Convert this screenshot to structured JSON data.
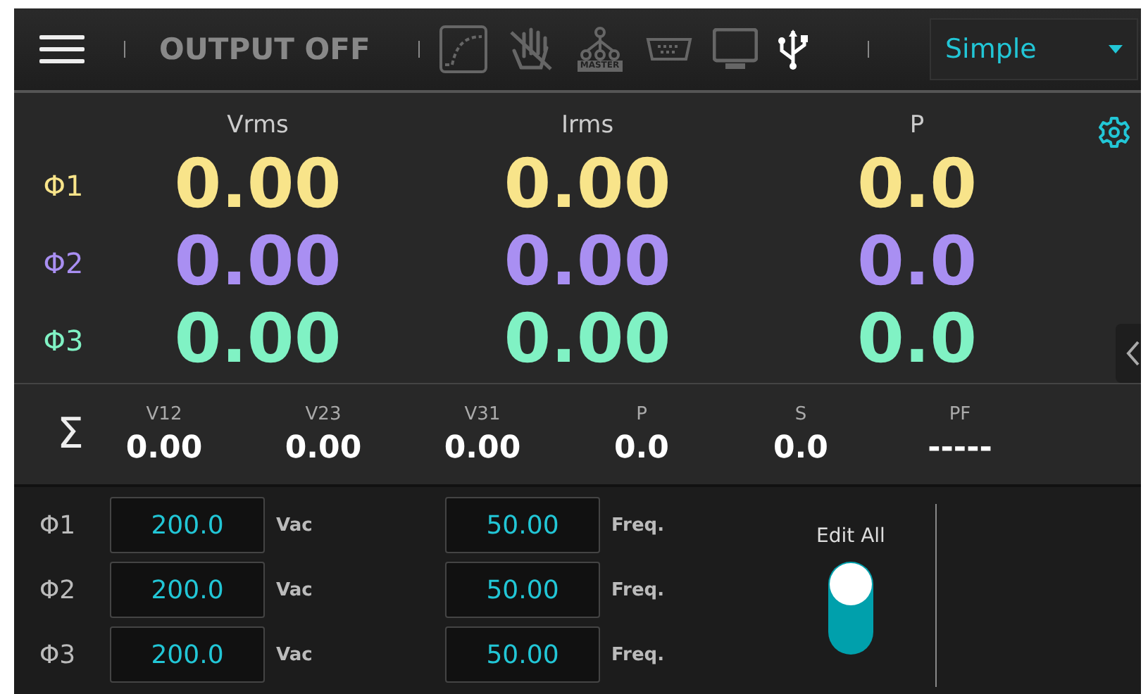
{
  "toolbar": {
    "status": "OUTPUT OFF",
    "master_icon_label": "MASTER",
    "mode_select": {
      "value": "Simple"
    }
  },
  "measurements": {
    "columns": [
      "Vrms",
      "Irms",
      "P"
    ],
    "phases": [
      {
        "label": "Φ1",
        "color": "#f8e48a",
        "values": [
          "0.00",
          "0.00",
          "0.0"
        ]
      },
      {
        "label": "Φ2",
        "color": "#a98ff2",
        "values": [
          "0.00",
          "0.00",
          "0.0"
        ]
      },
      {
        "label": "Φ3",
        "color": "#80f2c4",
        "values": [
          "0.00",
          "0.00",
          "0.0"
        ]
      }
    ]
  },
  "sum": {
    "symbol": "Σ",
    "items": [
      {
        "label": "V12",
        "value": "0.00"
      },
      {
        "label": "V23",
        "value": "0.00"
      },
      {
        "label": "V31",
        "value": "0.00"
      },
      {
        "label": "P",
        "value": "0.0"
      },
      {
        "label": "S",
        "value": "0.0"
      },
      {
        "label": "PF",
        "value": "-----"
      }
    ]
  },
  "settings": {
    "rows": [
      {
        "label": "Φ1",
        "voltage": "200.0",
        "voltage_unit": "Vac",
        "frequency": "50.00",
        "frequency_unit": "Freq."
      },
      {
        "label": "Φ2",
        "voltage": "200.0",
        "voltage_unit": "Vac",
        "frequency": "50.00",
        "frequency_unit": "Freq."
      },
      {
        "label": "Φ3",
        "voltage": "200.0",
        "voltage_unit": "Vac",
        "frequency": "50.00",
        "frequency_unit": "Freq."
      }
    ],
    "edit_all": {
      "label": "Edit All",
      "on": true
    }
  }
}
